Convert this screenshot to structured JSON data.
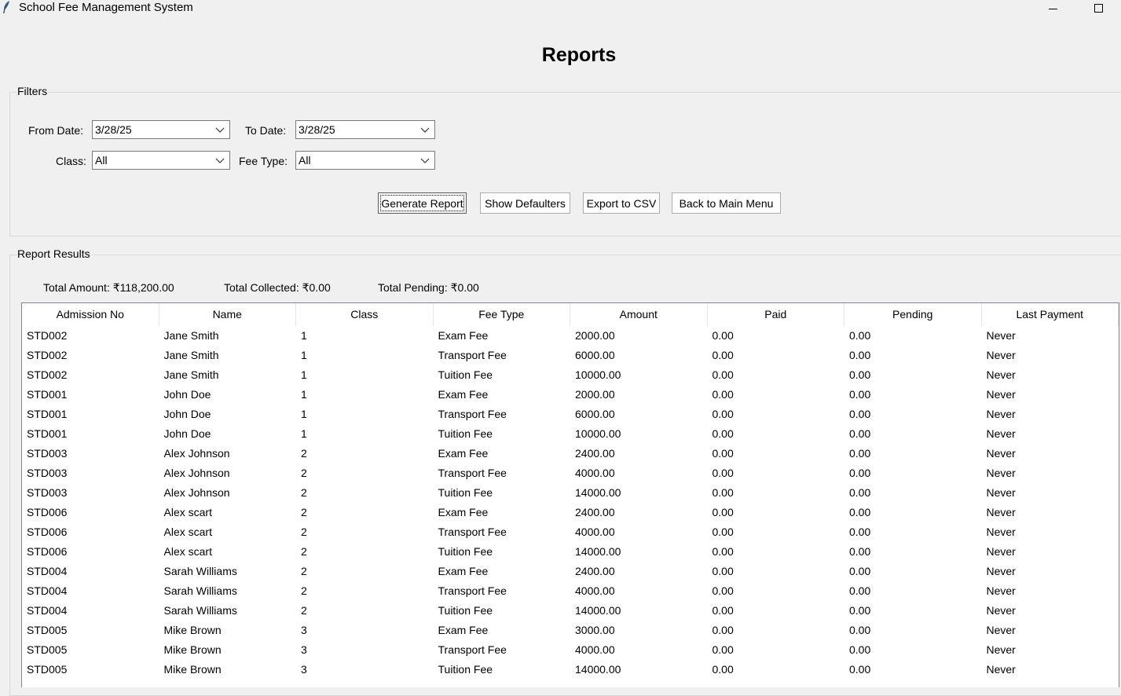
{
  "window": {
    "title": "School Fee Management System"
  },
  "heading": "Reports",
  "filters": {
    "legend": "Filters",
    "from_date": {
      "label": "From Date:",
      "value": "3/28/25"
    },
    "to_date": {
      "label": "To Date:",
      "value": "3/28/25"
    },
    "class": {
      "label": "Class:",
      "value": "All"
    },
    "fee_type": {
      "label": "Fee Type:",
      "value": "All"
    },
    "buttons": {
      "generate": "Generate Report",
      "defaulters": "Show Defaulters",
      "export": "Export to CSV",
      "back": "Back to Main Menu"
    }
  },
  "results": {
    "legend": "Report Results",
    "total_amount": "Total Amount: ₹118,200.00",
    "total_collected": "Total Collected: ₹0.00",
    "total_pending": "Total Pending: ₹0.00",
    "columns": [
      "Admission No",
      "Name",
      "Class",
      "Fee Type",
      "Amount",
      "Paid",
      "Pending",
      "Last Payment"
    ],
    "rows": [
      [
        "STD002",
        "Jane Smith",
        "1",
        "Exam Fee",
        "2000.00",
        "0.00",
        "0.00",
        "Never"
      ],
      [
        "STD002",
        "Jane Smith",
        "1",
        "Transport Fee",
        "6000.00",
        "0.00",
        "0.00",
        "Never"
      ],
      [
        "STD002",
        "Jane Smith",
        "1",
        "Tuition Fee",
        "10000.00",
        "0.00",
        "0.00",
        "Never"
      ],
      [
        "STD001",
        "John Doe",
        "1",
        "Exam Fee",
        "2000.00",
        "0.00",
        "0.00",
        "Never"
      ],
      [
        "STD001",
        "John Doe",
        "1",
        "Transport Fee",
        "6000.00",
        "0.00",
        "0.00",
        "Never"
      ],
      [
        "STD001",
        "John Doe",
        "1",
        "Tuition Fee",
        "10000.00",
        "0.00",
        "0.00",
        "Never"
      ],
      [
        "STD003",
        "Alex Johnson",
        "2",
        "Exam Fee",
        "2400.00",
        "0.00",
        "0.00",
        "Never"
      ],
      [
        "STD003",
        "Alex Johnson",
        "2",
        "Transport Fee",
        "4000.00",
        "0.00",
        "0.00",
        "Never"
      ],
      [
        "STD003",
        "Alex Johnson",
        "2",
        "Tuition Fee",
        "14000.00",
        "0.00",
        "0.00",
        "Never"
      ],
      [
        "STD006",
        "Alex scart",
        "2",
        "Exam Fee",
        "2400.00",
        "0.00",
        "0.00",
        "Never"
      ],
      [
        "STD006",
        "Alex scart",
        "2",
        "Transport Fee",
        "4000.00",
        "0.00",
        "0.00",
        "Never"
      ],
      [
        "STD006",
        "Alex scart",
        "2",
        "Tuition Fee",
        "14000.00",
        "0.00",
        "0.00",
        "Never"
      ],
      [
        "STD004",
        "Sarah Williams",
        "2",
        "Exam Fee",
        "2400.00",
        "0.00",
        "0.00",
        "Never"
      ],
      [
        "STD004",
        "Sarah Williams",
        "2",
        "Transport Fee",
        "4000.00",
        "0.00",
        "0.00",
        "Never"
      ],
      [
        "STD004",
        "Sarah Williams",
        "2",
        "Tuition Fee",
        "14000.00",
        "0.00",
        "0.00",
        "Never"
      ],
      [
        "STD005",
        "Mike Brown",
        "3",
        "Exam Fee",
        "3000.00",
        "0.00",
        "0.00",
        "Never"
      ],
      [
        "STD005",
        "Mike Brown",
        "3",
        "Transport Fee",
        "4000.00",
        "0.00",
        "0.00",
        "Never"
      ],
      [
        "STD005",
        "Mike Brown",
        "3",
        "Tuition Fee",
        "14000.00",
        "0.00",
        "0.00",
        "Never"
      ]
    ]
  },
  "icons": {
    "app": "feather-icon",
    "minimize": "minimize-icon",
    "maximize": "maximize-icon",
    "dropdown": "chevron-down-icon"
  }
}
